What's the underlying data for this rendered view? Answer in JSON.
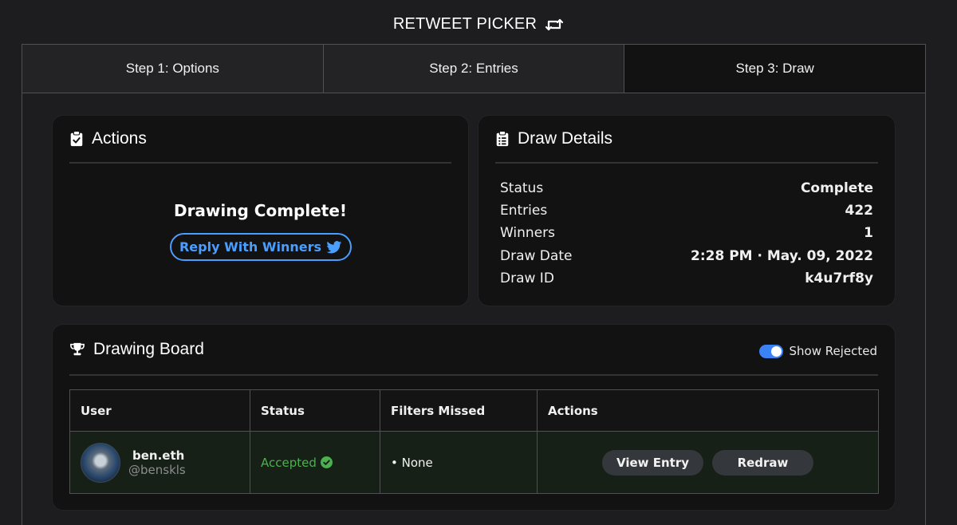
{
  "app": {
    "title": "RETWEET PICKER",
    "title_icon": "retweet-icon"
  },
  "tabs": [
    {
      "label": "Step 1: Options",
      "active": false
    },
    {
      "label": "Step 2: Entries",
      "active": false
    },
    {
      "label": "Step 3: Draw",
      "active": true
    }
  ],
  "actions": {
    "title": "Actions",
    "icon": "clipboard-check-icon",
    "message": "Drawing Complete!",
    "reply_button": "Reply With Winners",
    "reply_icon": "twitter-bird-icon",
    "accent_color": "#4a9eff"
  },
  "details": {
    "title": "Draw Details",
    "icon": "clipboard-list-icon",
    "rows": [
      {
        "label": "Status",
        "value": "Complete"
      },
      {
        "label": "Entries",
        "value": "422"
      },
      {
        "label": "Winners",
        "value": "1"
      },
      {
        "label": "Draw Date",
        "value": "2:28 PM · May. 09, 2022"
      },
      {
        "label": "Draw ID",
        "value": "k4u7rf8y"
      }
    ]
  },
  "board": {
    "title": "Drawing Board",
    "icon": "trophy-icon",
    "toggle_label": "Show Rejected",
    "toggle_on": true,
    "columns": [
      "User",
      "Status",
      "Filters Missed",
      "Actions"
    ],
    "rows": [
      {
        "name": "ben.eth",
        "handle": "@benskls",
        "status": "Accepted",
        "status_color": "#4caf50",
        "filters_missed": "• None",
        "view_button": "View Entry",
        "redraw_button": "Redraw"
      }
    ]
  }
}
